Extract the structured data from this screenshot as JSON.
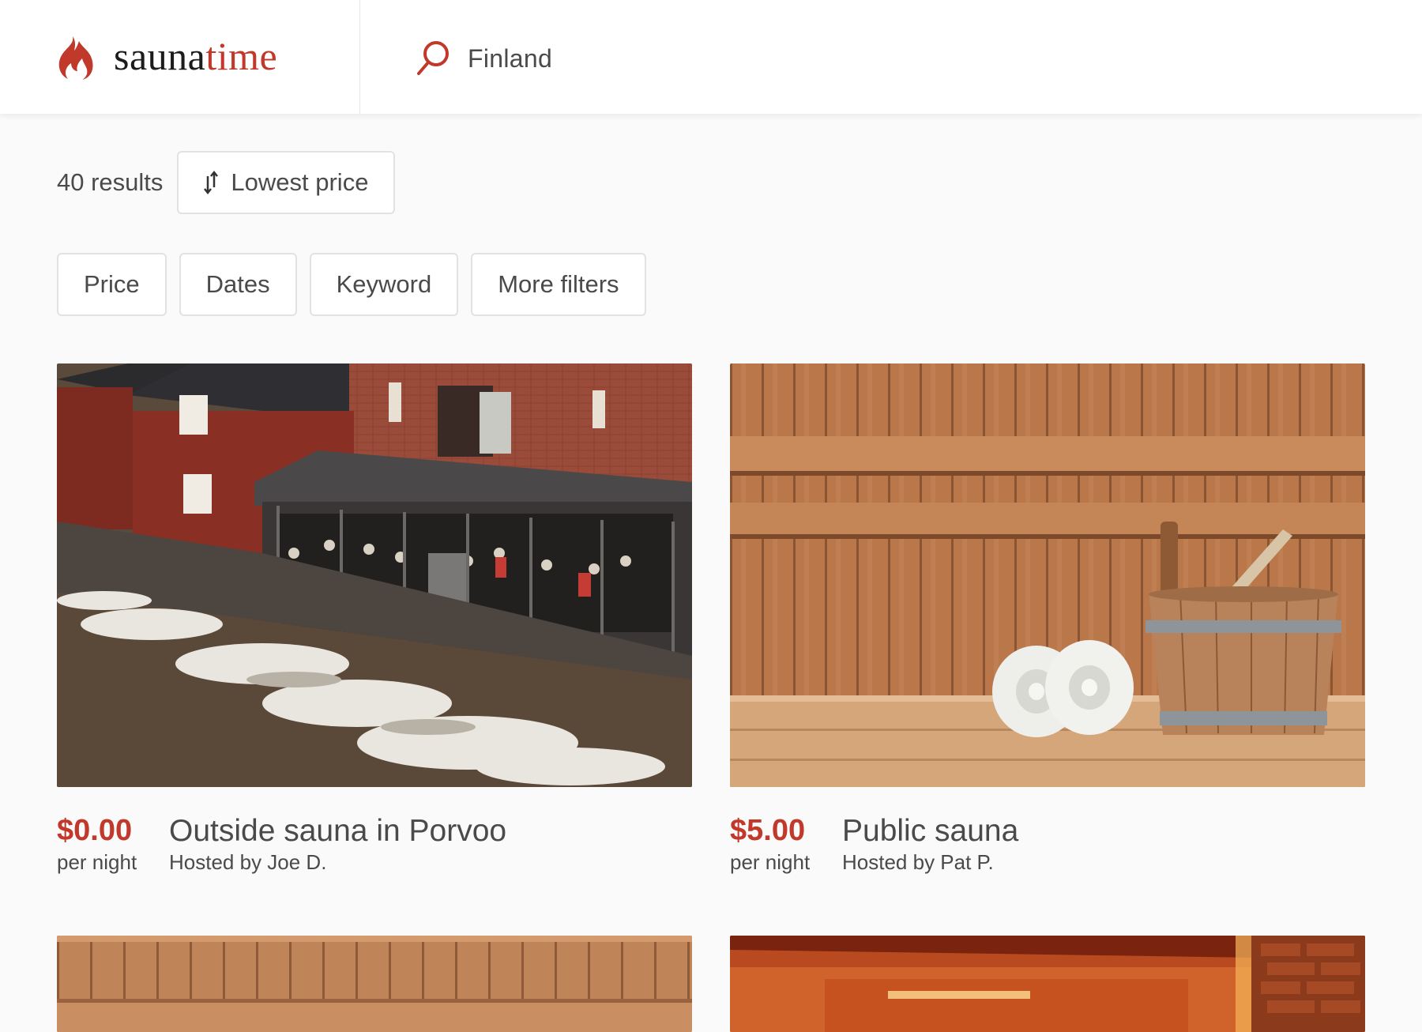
{
  "brand": {
    "name_part1": "sauna",
    "name_part2": "time",
    "accent": "#c0392b",
    "icon": "flame-icon"
  },
  "search": {
    "value": "Finland",
    "icon": "search-icon"
  },
  "results": {
    "count_label": "40 results",
    "sort_label": "Lowest price",
    "sort_icon": "sort-arrows-icon"
  },
  "filters": [
    "Price",
    "Dates",
    "Keyword",
    "More filters"
  ],
  "listings": [
    {
      "price": "$0.00",
      "unit": "per night",
      "title": "Outside sauna in Porvoo",
      "host": "Hosted by Joe D."
    },
    {
      "price": "$5.00",
      "unit": "per night",
      "title": "Public sauna",
      "host": "Hosted by Pat P."
    }
  ]
}
